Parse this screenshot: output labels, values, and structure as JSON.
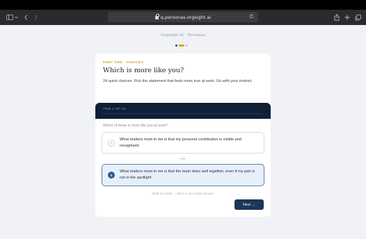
{
  "browser": {
    "url": "q.personas.orgsight.ai",
    "icons": [
      "sidebar-icon",
      "chevron-down-icon",
      "back-icon",
      "forward-icon",
      "lock-icon",
      "reload-icon",
      "share-icon",
      "plus-icon",
      "tabs-icon"
    ]
  },
  "page": {
    "brand": "Orgsight AI · Personas",
    "progress": {
      "current": 2,
      "total": 3
    }
  },
  "intro": {
    "part": "PART TWO · CHOICES",
    "heading": "Which is more like you?",
    "description": "24 quick choices. Pick the statement that feels more true at work. Go with your instinct."
  },
  "quiz": {
    "counter": "ITEM 1 OF 24",
    "question": "Which of these is more like you at work?",
    "option_a": {
      "key": "A",
      "text": "What matters most to me is that my personal contribution is visible and recognised"
    },
    "divider": "OR",
    "option_b": {
      "key": "B",
      "text": "What matters most to me is that the team does well together, even if my part is not in the spotlight",
      "selected": true
    },
    "note": "Both are valid — there is no correct answer",
    "next_label": "Next →"
  },
  "colors": {
    "accent": "#e0a31f",
    "navy": "#0e1f36",
    "button": "#1c3657",
    "selected_bg": "#e7f0fa"
  }
}
